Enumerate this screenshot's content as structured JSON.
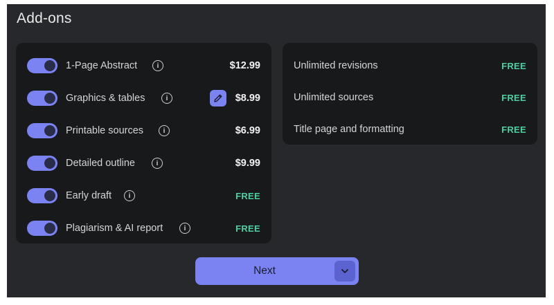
{
  "page": {
    "title": "Add-ons"
  },
  "addons": [
    {
      "label": "1-Page Abstract",
      "price": "$12.99",
      "enabled": true,
      "free": false
    },
    {
      "label": "Graphics & tables",
      "price": "$8.99",
      "enabled": true,
      "free": false,
      "editable": true
    },
    {
      "label": "Printable sources",
      "price": "$6.99",
      "enabled": true,
      "free": false
    },
    {
      "label": "Detailed outline",
      "price": "$9.99",
      "enabled": true,
      "free": false
    },
    {
      "label": "Early draft",
      "price": "FREE",
      "enabled": true,
      "free": true
    },
    {
      "label": "Plagiarism & AI report",
      "price": "FREE",
      "enabled": true,
      "free": true
    }
  ],
  "included": [
    {
      "label": "Unlimited revisions",
      "price": "FREE"
    },
    {
      "label": "Unlimited sources",
      "price": "FREE"
    },
    {
      "label": "Title page and formatting",
      "price": "FREE"
    }
  ],
  "footer": {
    "next_label": "Next"
  },
  "colors": {
    "accent": "#7b83f3",
    "free": "#4fd0a3",
    "panel": "#27282b",
    "card": "#18191b"
  },
  "icons": {
    "info": "info-icon",
    "edit": "pencil-icon",
    "chevron": "chevron-down-icon"
  }
}
